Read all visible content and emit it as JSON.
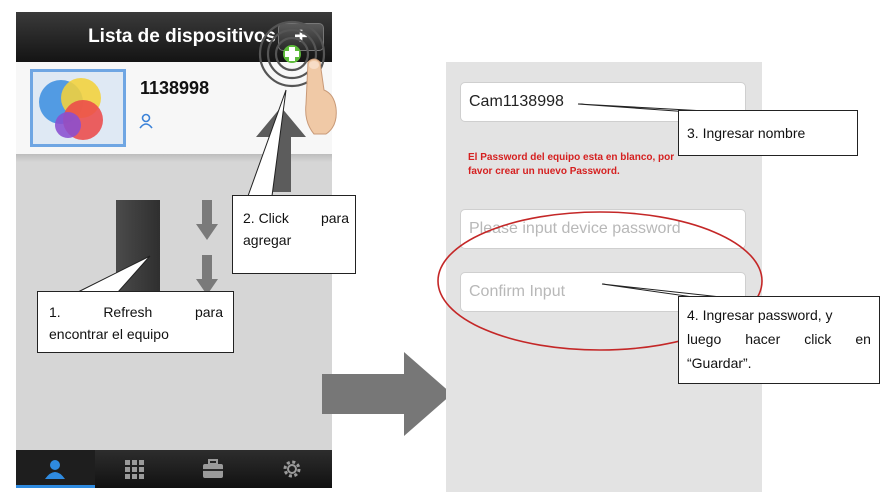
{
  "left_screen": {
    "header_title": "Lista de dispositivos",
    "add_button_label": "+",
    "device": {
      "id": "1138998"
    },
    "tabs": [
      {
        "icon": "user-icon",
        "active": true
      },
      {
        "icon": "grid-icon",
        "active": false
      },
      {
        "icon": "briefcase-icon",
        "active": false
      },
      {
        "icon": "gear-icon",
        "active": false
      }
    ]
  },
  "right_screen": {
    "name_value": "Cam1138998",
    "warning_line1": "El Password del equipo esta en blanco, por",
    "warning_line2": "favor crear un nuevo Password.",
    "password_placeholder": "Please input device password",
    "confirm_placeholder": "Confirm Input"
  },
  "callouts": {
    "c1_w1": "1.",
    "c1_w2": "Refresh",
    "c1_w3": "para",
    "c1_line2": "encontrar el equipo",
    "c2_line1a": "2. Click",
    "c2_line1b": "para",
    "c2_line2": "agregar",
    "c3": "3. Ingresar nombre",
    "c4_line1": "4. Ingresar password, y",
    "c4_l2a": "luego",
    "c4_l2b": "hacer",
    "c4_l2c": "click",
    "c4_l2d": "en",
    "c4_line3": "“Guardar”."
  },
  "colors": {
    "accent_blue": "#2f8be0",
    "warning_red": "#d52020",
    "add_green": "#5dbb3a"
  }
}
